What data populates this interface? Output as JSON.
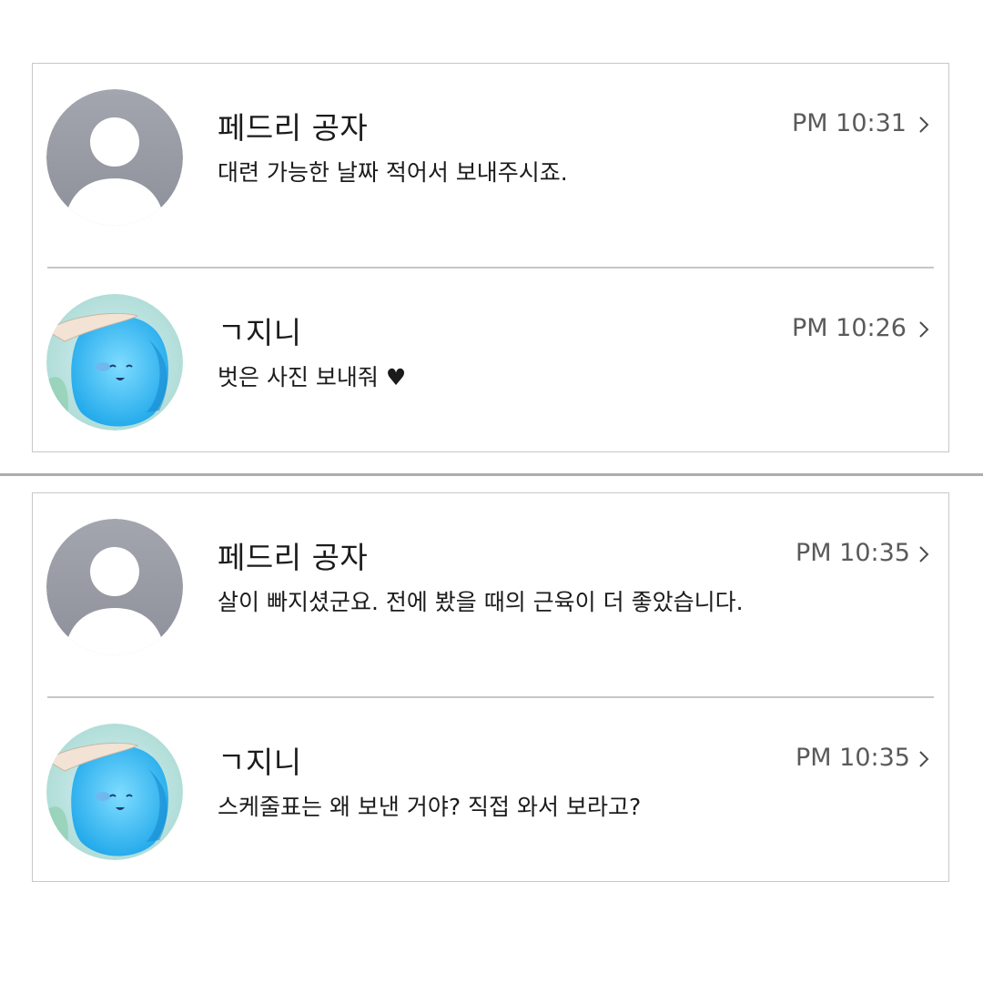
{
  "panels": [
    {
      "notifications": [
        {
          "sender": "페드리 공자",
          "message": "대련 가능한 날짜 적어서 보내주시죠.",
          "time": "PM 10:31",
          "avatar": "default-person-icon"
        },
        {
          "sender": "ㄱ지니",
          "message": "벗은 사진 보내줘 ♥",
          "time": "PM 10:26",
          "avatar": "blue-character-avatar"
        }
      ]
    },
    {
      "notifications": [
        {
          "sender": "페드리 공자",
          "message": "살이 빠지셨군요. 전에 봤을 때의 근육이 더 좋았습니다.",
          "time": "PM 10:35",
          "avatar": "default-person-icon"
        },
        {
          "sender": "ㄱ지니",
          "message": "스케줄표는 왜 보낸 거야? 직접 와서 보라고?",
          "time": "PM 10:35",
          "avatar": "blue-character-avatar"
        }
      ]
    }
  ],
  "colors": {
    "default_avatar_bg": "#9ea1aa",
    "text": "#1b1b1b",
    "time": "#5a5a5a",
    "border": "#c8c8c8"
  }
}
